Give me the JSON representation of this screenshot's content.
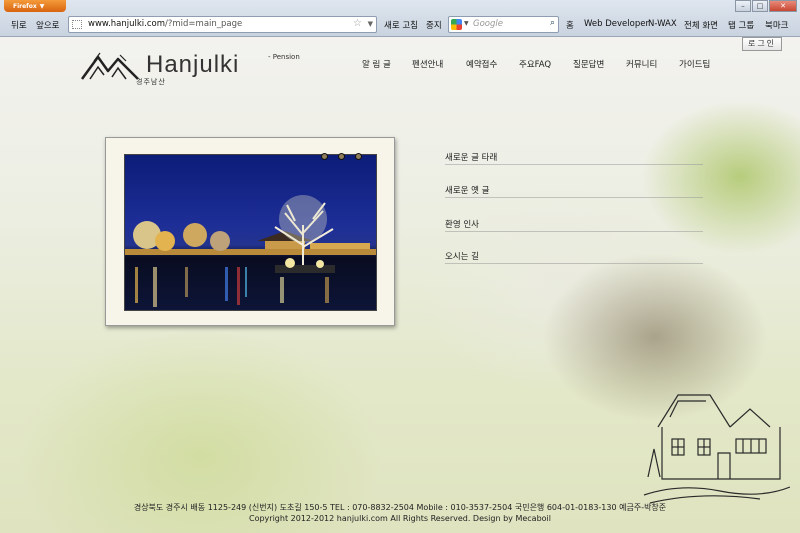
{
  "browser": {
    "app_button": "Firefox",
    "back": "뒤로",
    "forward": "앞으로",
    "url_domain": "www.hanjulki.com",
    "url_path": "/?mid=main_page",
    "reload": "새로 고침",
    "stop": "중지",
    "search_placeholder": "Google",
    "toolbar_items": [
      "홈",
      "Web Developer",
      "N-WAX",
      "전체 화면",
      "탭 그룹",
      "북마크"
    ]
  },
  "site": {
    "logo_name": "Hanjulki",
    "logo_sub": "- Pension",
    "logo_korean": "경주남산",
    "login": "로그인",
    "menu": [
      "알 림 글",
      "펜션안내",
      "예약접수",
      "주요FAQ",
      "질문답변",
      "커뮤니티",
      "가이드팁"
    ],
    "posts": [
      "새로운 글 타래",
      "새로운 옛 글",
      "환영 인사",
      "오시는 길"
    ],
    "footer_line1": "경상북도 경주시 배동 1125-249 (신번지) 도초길 150-5      TEL : 070-8832-2504   Mobile : 010-3537-2504    국민은행 604-01-0183-130 예금주-박창준",
    "footer_line2": "Copyright 2012-2012 hanjulki.com All Rights Reserved.    Design by Mecaboil"
  },
  "colors": {
    "accent_orange": "#e07a1f",
    "night_sky": "#1d2e97"
  }
}
